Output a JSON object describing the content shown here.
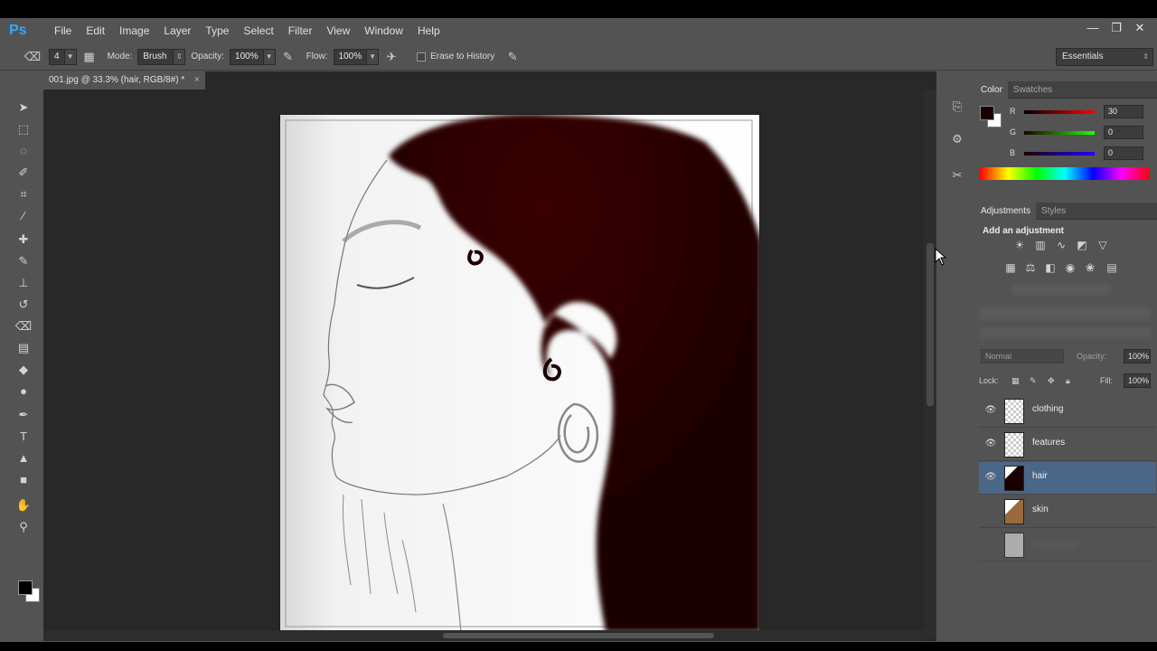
{
  "app": {
    "logo": "Ps"
  },
  "menu": [
    "File",
    "Edit",
    "Image",
    "Layer",
    "Type",
    "Select",
    "Filter",
    "View",
    "Window",
    "Help"
  ],
  "window_controls": {
    "minimize": "—",
    "restore": "❐",
    "close": "✕"
  },
  "options": {
    "brush_size": "4",
    "mode_label": "Mode:",
    "mode_value": "Brush",
    "opacity_label": "Opacity:",
    "opacity_value": "100%",
    "flow_label": "Flow:",
    "flow_value": "100%",
    "erase_history_label": "Erase to History",
    "workspace": "Essentials"
  },
  "document": {
    "tab_title": "001.jpg @ 33.3% (hair, RGB/8#) *",
    "close": "×"
  },
  "color_panel": {
    "tabs": [
      "Color",
      "Swatches"
    ],
    "r_label": "R",
    "r_value": "30",
    "g_label": "G",
    "g_value": "0",
    "b_label": "B",
    "b_value": "0",
    "foreground": "#1e0000"
  },
  "adjustments_panel": {
    "tabs": [
      "Adjustments",
      "Styles"
    ],
    "title": "Add an adjustment"
  },
  "layers_panel": {
    "blend_mode": "Normal",
    "opacity_label": "Opacity:",
    "opacity_value": "100%",
    "lock_label": "Lock:",
    "fill_label": "Fill:",
    "fill_value": "100%",
    "layers": [
      {
        "name": "clothing",
        "visible": true,
        "selected": false
      },
      {
        "name": "features",
        "visible": true,
        "selected": false
      },
      {
        "name": "hair",
        "visible": true,
        "selected": true
      },
      {
        "name": "skin",
        "visible": false,
        "selected": false
      }
    ]
  }
}
